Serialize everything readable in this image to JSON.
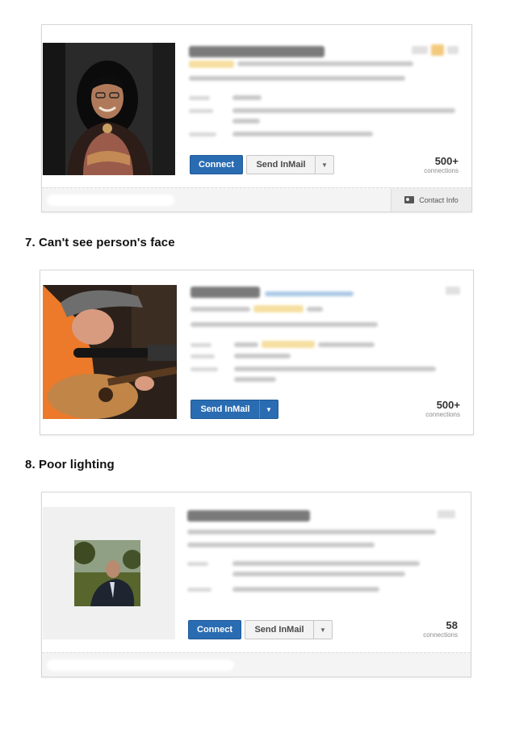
{
  "cards": [
    {
      "connect_label": "Connect",
      "inmail_label": "Send InMail",
      "connections_count": "500+",
      "connections_label": "connections",
      "contact_info_label": "Contact Info"
    },
    {
      "inmail_label": "Send InMail",
      "connections_count": "500+",
      "connections_label": "connections"
    },
    {
      "connect_label": "Connect",
      "inmail_label": "Send InMail",
      "connections_count": "58",
      "connections_label": "connections"
    }
  ],
  "headings": [
    "7. Can't see person's face",
    "8. Poor lighting"
  ],
  "colors": {
    "primary_button": "#2a6cb2",
    "highlight": "#f6dfa0"
  },
  "icons": [
    "chevron-down-icon",
    "contact-card-icon"
  ]
}
